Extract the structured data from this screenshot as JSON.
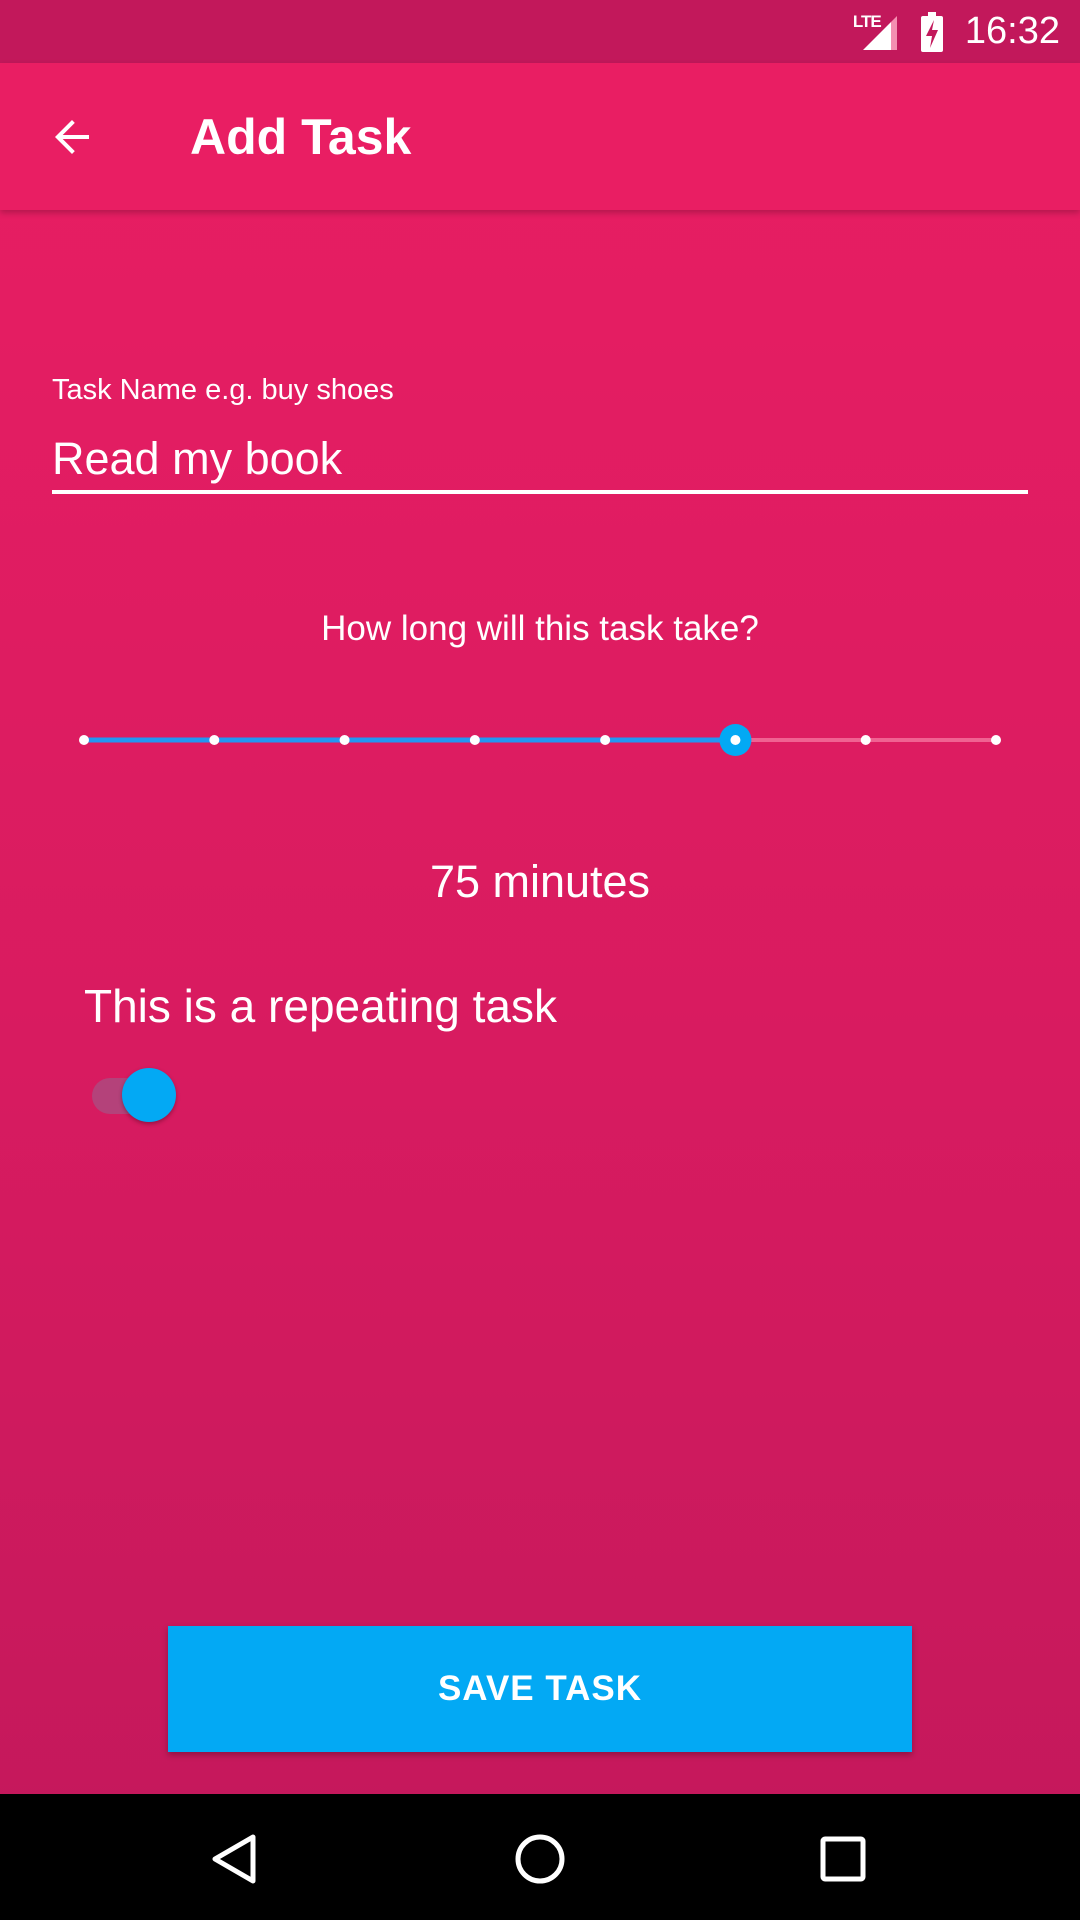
{
  "status_bar": {
    "network": "LTE",
    "time": "16:32"
  },
  "app_bar": {
    "title": "Add Task",
    "back_icon": "arrow-back-icon"
  },
  "form": {
    "task_name_label": "Task Name e.g. buy shoes",
    "task_name_value": "Read my book",
    "duration_question": "How long will this task take?",
    "duration_value_text": "75 minutes",
    "repeating_label": "This is a repeating task",
    "repeating_on": true
  },
  "slider": {
    "steps": 8,
    "selected_index": 5,
    "active_color": "#2196f3",
    "inactive_color": "#f06292",
    "thumb_color": "#03a9f4"
  },
  "actions": {
    "save_label": "SAVE TASK"
  },
  "colors": {
    "primary": "#e91e63",
    "primary_dark": "#c2185b",
    "accent": "#03a9f4"
  },
  "nav_bar": {
    "back_icon": "nav-back-icon",
    "home_icon": "nav-home-icon",
    "recents_icon": "nav-recents-icon"
  }
}
